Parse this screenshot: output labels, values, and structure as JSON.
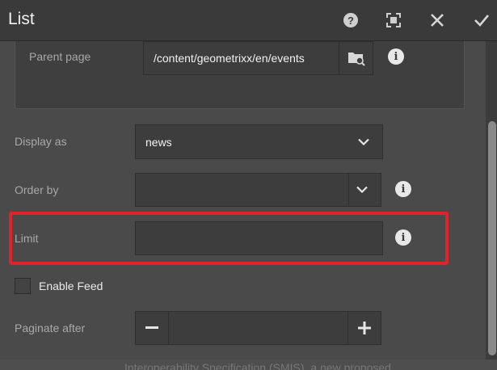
{
  "header": {
    "title": "List",
    "help_icon_glyph": "?"
  },
  "form": {
    "parent_page": {
      "label": "Parent page",
      "value": "/content/geometrixx/en/events"
    },
    "display_as": {
      "label": "Display as",
      "value": "news"
    },
    "order_by": {
      "label": "Order by",
      "value": ""
    },
    "limit": {
      "label": "Limit",
      "value": ""
    },
    "enable_feed": {
      "label": "Enable Feed",
      "checked": false
    },
    "paginate_after": {
      "label": "Paginate after",
      "value": ""
    }
  },
  "info_glyph": "i",
  "background_text": "Interoperability Specification (SMIS), a new proposed",
  "colors": {
    "dialog_bg": "#4a4a4a",
    "header_bg": "#3a3a3a",
    "field_bg": "#3d3d3d",
    "highlight": "#e0232a"
  }
}
